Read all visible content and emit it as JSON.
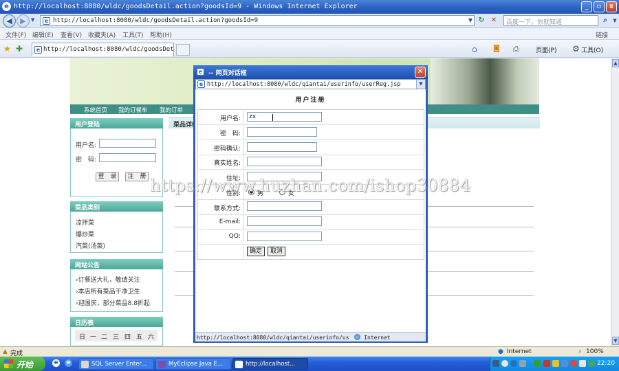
{
  "window": {
    "title": "http://localhost:8080/wldc/goodsDetail.action?goodsId=9 - Windows Internet Explorer",
    "buttons": [
      "_",
      "▫",
      "x"
    ]
  },
  "addressbar": {
    "url": "http://localhost:8080/wldc/goodsDetail.action?goodsId=9",
    "search_placeholder": "百度一下，你就知道"
  },
  "menu": {
    "items": [
      "文件(F)",
      "编辑(E)",
      "查看(V)",
      "收藏夹(A)",
      "工具(T)",
      "帮助(H)"
    ],
    "right": "链接"
  },
  "tab": {
    "title": "http://localhost:8080/wldc/goodsDetail.ac..."
  },
  "commandbar": {
    "page": "页面(P)",
    "tools": "工具(O)"
  },
  "site": {
    "nav": [
      "系统首页",
      "我的订餐车",
      "我的订单"
    ],
    "content_head": "菜品详细",
    "login": {
      "title": "用户登陆",
      "username_label": "用户名:",
      "password_label": "密　码:",
      "login_button": "登　录",
      "register_button": "注　册"
    },
    "categories": {
      "title": "菜品类别",
      "items": [
        "凉拌菜",
        "爆炒菜",
        "汽菜(汤菜)"
      ]
    },
    "notices": {
      "title": "网站公告",
      "items": [
        "订餐送大礼，敬请关注",
        "本店所有菜品干净卫生",
        "迎国庆，部分菜品8.8折起"
      ]
    },
    "calendar": {
      "title": "日历表",
      "days": [
        "日",
        "一",
        "二",
        "三",
        "四",
        "五",
        "六"
      ]
    }
  },
  "watermark": "https://www.huzhan.com/ishop30884",
  "dialog": {
    "title": "-- 网页对话框",
    "url": "http://localhost:8080/wldc/qiantai/userinfo/userReg.jsp",
    "heading": "用户注册",
    "fields": [
      {
        "label": "用户名:",
        "value": "zx"
      },
      {
        "label": "密　码:",
        "value": ""
      },
      {
        "label": "密码确认:",
        "value": ""
      },
      {
        "label": "真实姓名:",
        "value": ""
      },
      {
        "label": "住址:",
        "value": ""
      },
      {
        "label": "性别:",
        "value": ""
      },
      {
        "label": "联系方式:",
        "value": ""
      },
      {
        "label": "E-mail:",
        "value": ""
      },
      {
        "label": "QQ:",
        "value": ""
      }
    ],
    "gender": {
      "male": "男",
      "female": "女",
      "selected": "male"
    },
    "confirm_button": "确定",
    "cancel_button": "取消",
    "status_url": "http://localhost:8080/wldc/qiantai/userinfo/us",
    "status_zone": "Internet"
  },
  "statusbar": {
    "left": "完成",
    "zone": "Internet",
    "zoom": "100%"
  },
  "taskbar": {
    "start": "开始",
    "tasks": [
      "SQL Server Enter...",
      "MyEclipse Java E...",
      "http://localhost..."
    ],
    "time": "22:20"
  },
  "colors": {
    "accent": "#2e5fc0",
    "site_green": "#4aa898",
    "nav_strip": "#3f8f87"
  }
}
